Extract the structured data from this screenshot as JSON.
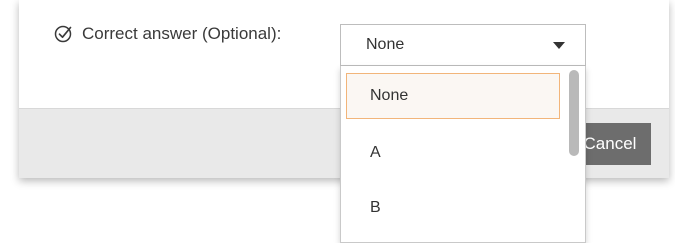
{
  "form": {
    "label": "Correct answer (Optional):",
    "select_value": "None"
  },
  "dropdown": {
    "options": [
      "None",
      "A",
      "B"
    ],
    "selected_index": 0
  },
  "footer": {
    "cancel_label": "Cancel"
  },
  "icons": {
    "label_icon": "check-circle-icon",
    "select_icon": "chevron-down-icon"
  },
  "colors": {
    "selected_border": "#f2b57a",
    "cancel_bg": "#6d6d6d",
    "footer_bg": "#e9e9e9"
  }
}
